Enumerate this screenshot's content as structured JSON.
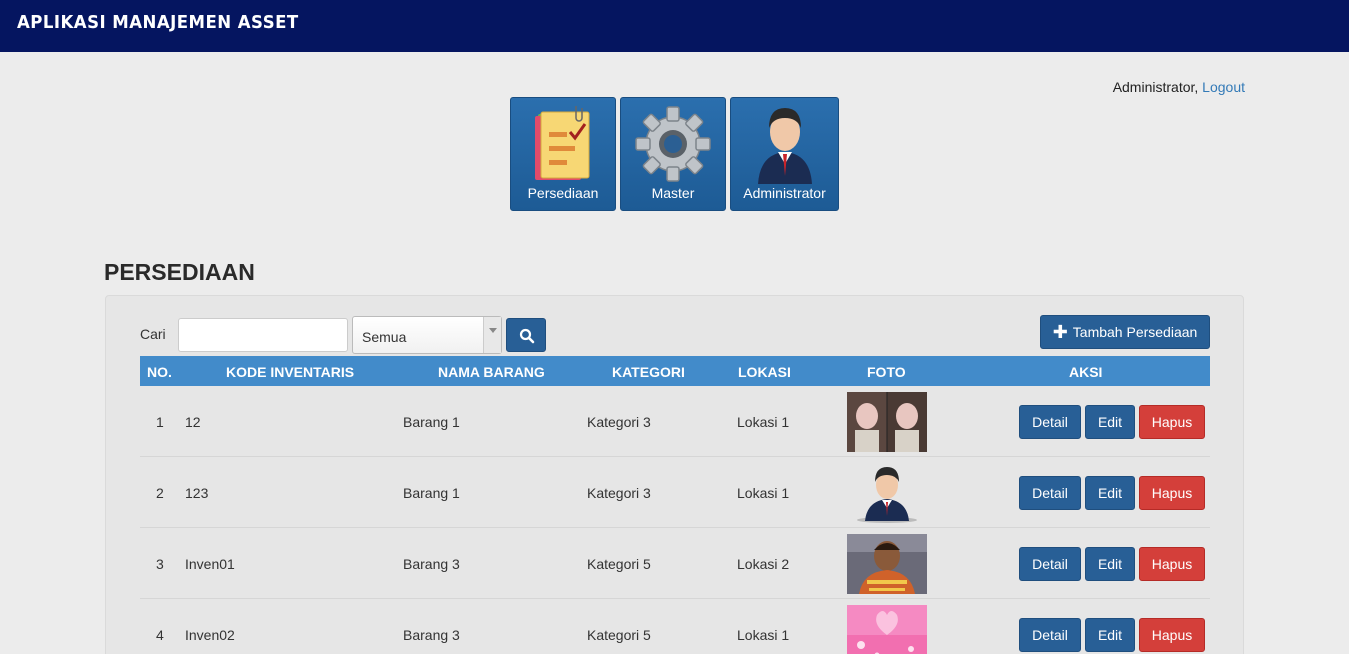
{
  "header": {
    "app_title": "APLIKASI MANAJEMEN ASSET"
  },
  "user": {
    "name": "Administrator,",
    "logout": "Logout"
  },
  "tiles": [
    {
      "label": "Persediaan",
      "icon": "notepad-checklist-icon"
    },
    {
      "label": "Master",
      "icon": "gear-icon"
    },
    {
      "label": "Administrator",
      "icon": "user-admin-icon"
    }
  ],
  "page": {
    "title": "PERSEDIAAN"
  },
  "search": {
    "label": "Cari",
    "value": "",
    "placeholder": "",
    "filter_selected": "Semua"
  },
  "actions": {
    "add_label": "Tambah Persediaan"
  },
  "table": {
    "headers": [
      "NO.",
      "KODE INVENTARIS",
      "NAMA BARANG",
      "KATEGORI",
      "LOKASI",
      "FOTO",
      "AKSI"
    ],
    "rows": [
      {
        "no": "1",
        "kode": "12",
        "nama": "Barang 1",
        "kategori": "Kategori 3",
        "lokasi": "Lokasi 1",
        "foto": "photo-thumbnail"
      },
      {
        "no": "2",
        "kode": "123",
        "nama": "Barang 1",
        "kategori": "Kategori 3",
        "lokasi": "Lokasi 1",
        "foto": "user-avatar-thumbnail"
      },
      {
        "no": "3",
        "kode": "Inven01",
        "nama": "Barang 3",
        "kategori": "Kategori 5",
        "lokasi": "Lokasi 2",
        "foto": "child-photo-thumbnail"
      },
      {
        "no": "4",
        "kode": "Inven02",
        "nama": "Barang 3",
        "kategori": "Kategori 5",
        "lokasi": "Lokasi 1",
        "foto": "pink-hearts-thumbnail"
      }
    ],
    "row_actions": {
      "detail": "Detail",
      "edit": "Edit",
      "hapus": "Hapus"
    }
  },
  "colors": {
    "topbar": "#051560",
    "primary": "#285f96",
    "table_header": "#428bca",
    "danger": "#d43f3a",
    "link": "#337ab7"
  }
}
